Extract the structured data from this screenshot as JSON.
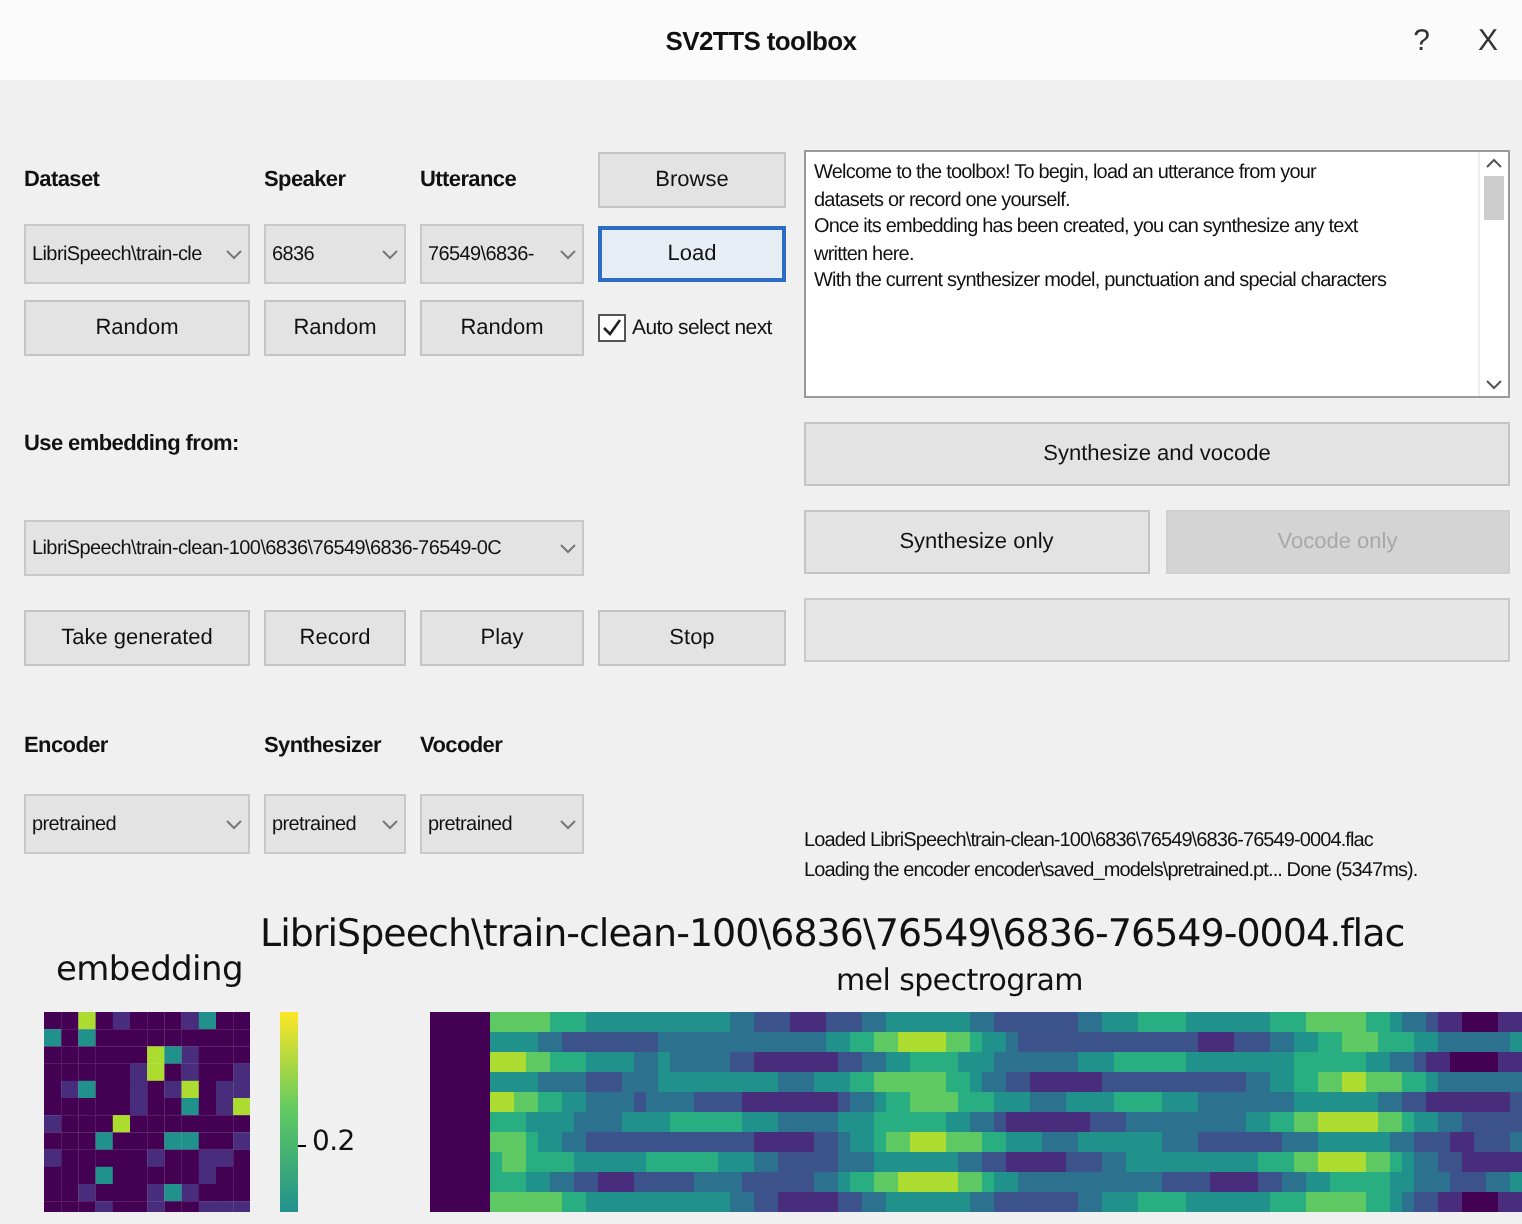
{
  "window": {
    "title": "SV2TTS toolbox",
    "help": "?",
    "close": "X"
  },
  "dataset_panel": {
    "labels": [
      "Dataset",
      "Speaker",
      "Utterance"
    ],
    "browse": {
      "label": "Browse"
    },
    "combos": [
      "LibriSpeech\\train-cle",
      "6836",
      "76549\\6836-"
    ],
    "load": {
      "label": "Load",
      "focused": true
    },
    "random_buttons": [
      "Random",
      "Random",
      "Random"
    ],
    "auto_select_next": {
      "label": "Auto select next",
      "checked": true
    }
  },
  "embedding_panel": {
    "label": "Use embedding from:",
    "combo": "LibriSpeech\\train-clean-100\\6836\\76549\\6836-76549-0C",
    "buttons": [
      "Take generated",
      "Record",
      "Play",
      "Stop"
    ]
  },
  "models_panel": {
    "labels": [
      "Encoder",
      "Synthesizer",
      "Vocoder"
    ],
    "combos": [
      "pretrained",
      "pretrained",
      "pretrained"
    ]
  },
  "text_box": {
    "lines": [
      "Welcome to the toolbox! To begin, load an utterance from your",
      "datasets or record one yourself.",
      "Once its embedding has been created, you can synthesize any text",
      "written here.",
      "With the current synthesizer model, punctuation and special characters"
    ]
  },
  "actions": [
    {
      "label": "Synthesize and vocode",
      "disabled": false
    },
    {
      "label": "Synthesize only",
      "disabled": false
    },
    {
      "label": "Vocode only",
      "disabled": true
    }
  ],
  "progress": {
    "level": 0
  },
  "log": [
    "Loaded LibriSpeech\\train-clean-100\\6836\\76549\\6836-76549-0004.flac",
    "Loading the encoder encoder\\saved_models\\pretrained.pt... Done (5347ms)."
  ],
  "plots": {
    "file_title": "LibriSpeech\\train-clean-100\\6836\\76549\\6836-76549-0004.flac",
    "embedding_title": "embedding",
    "colorbar_tick": "0.2",
    "spectrogram_title": "mel spectrogram"
  }
}
